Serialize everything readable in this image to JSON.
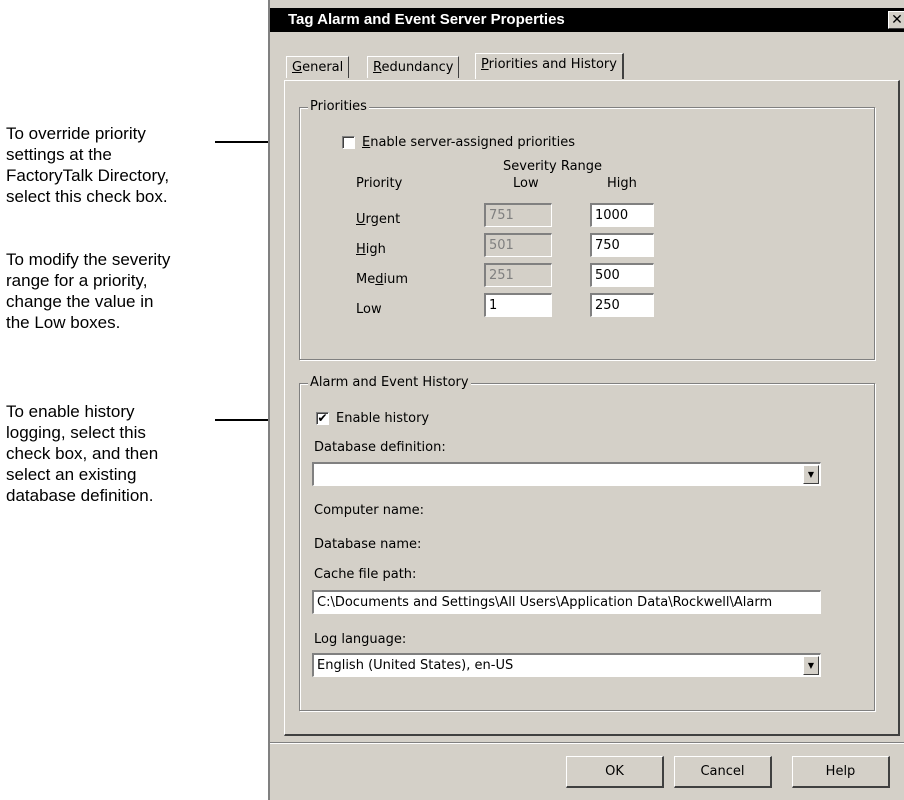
{
  "annotations": [
    {
      "text": "To override priority\nsettings at the\nFactoryTalk Directory,\nselect this check box."
    },
    {
      "text": "To modify the severity\nrange for a priority,\nchange the value in\nthe Low boxes."
    },
    {
      "text": "To enable history\nlogging, select this\ncheck box, and then\nselect an existing\ndatabase definition."
    }
  ],
  "dialog": {
    "title": "Tag Alarm and Event Server Properties",
    "close_label": "✕",
    "tabs": [
      {
        "mnemonic": "G",
        "rest": "eneral",
        "active": false
      },
      {
        "mnemonic": "R",
        "rest": "edundancy",
        "active": false
      },
      {
        "mnemonic": "P",
        "rest": "riorities and History",
        "active": true
      }
    ],
    "priorities": {
      "group_label": "Priorities",
      "enable_checkbox": {
        "mnemonic": "E",
        "rest": "nable server-assigned priorities",
        "checked": false
      },
      "severity_range_header": "Severity Range",
      "col_priority": "Priority",
      "col_low": "Low",
      "col_high": "High",
      "rows": [
        {
          "pre": "",
          "mnemonic": "U",
          "post": "rgent",
          "low": "751",
          "high": "1000",
          "low_disabled": true
        },
        {
          "pre": "",
          "mnemonic": "H",
          "post": "igh",
          "low": "501",
          "high": "750",
          "low_disabled": true
        },
        {
          "pre": "Me",
          "mnemonic": "d",
          "post": "ium",
          "low": "251",
          "high": "500",
          "low_disabled": true
        },
        {
          "pre": "Low",
          "mnemonic": "",
          "post": "",
          "low": "1",
          "high": "250",
          "low_disabled": false
        }
      ]
    },
    "history": {
      "group_label": "Alarm and Event History",
      "enable_checkbox": {
        "label": "Enable history",
        "checked": true,
        "mark": "✔"
      },
      "database_definition_label": "Database definition:",
      "database_definition_value": "",
      "computer_name_label": "Computer name:",
      "database_name_label": "Database name:",
      "cache_file_path_label": "Cache file path:",
      "cache_file_path_value": "C:\\Documents and Settings\\All Users\\Application Data\\Rockwell\\Alarm",
      "log_language_label": "Log language:",
      "log_language_value": "English (United States), en-US",
      "dropdown_glyph": "▼"
    },
    "buttons": {
      "ok": "OK",
      "cancel": "Cancel",
      "help": "Help"
    }
  }
}
